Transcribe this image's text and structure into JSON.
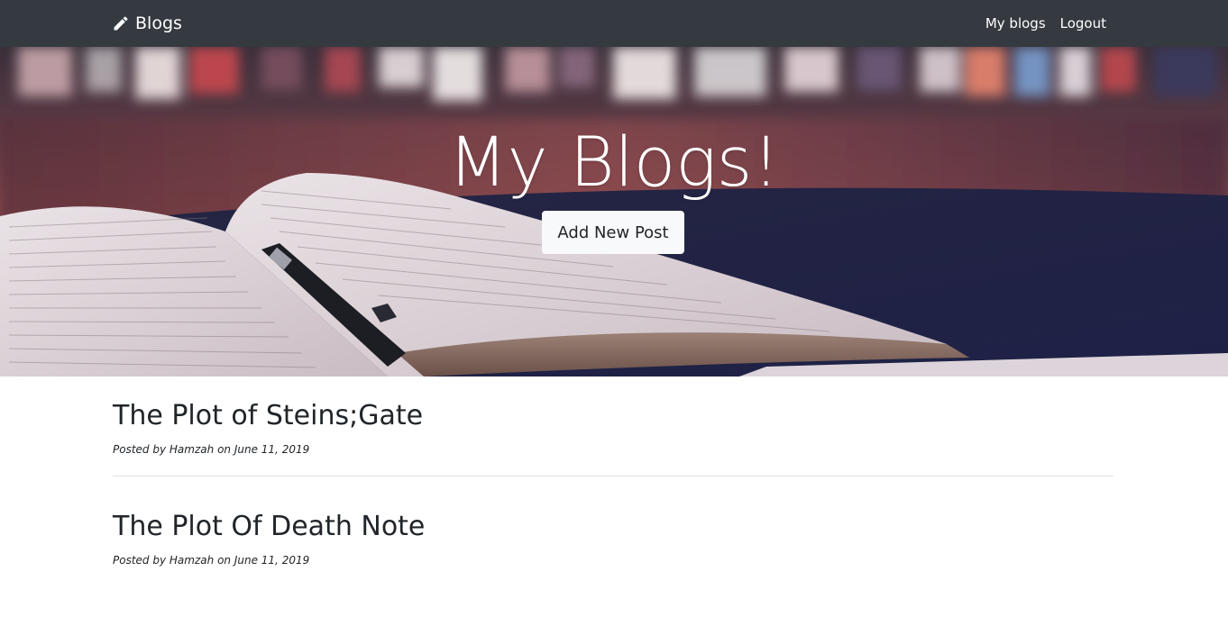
{
  "navbar": {
    "brand": "Blogs",
    "links": [
      "My blogs",
      "Logout"
    ]
  },
  "hero": {
    "title": "My Blogs!",
    "button_label": "Add New Post"
  },
  "posts": [
    {
      "title": "The Plot of Steins;Gate",
      "meta_prefix": "Posted by",
      "author": "Hamzah",
      "meta_mid": "on",
      "date": "June 11, 2019"
    },
    {
      "title": "The Plot Of Death Note",
      "meta_prefix": "Posted by",
      "author": "Hamzah",
      "meta_mid": "on",
      "date": "June 11, 2019"
    }
  ],
  "colors": {
    "navbar_bg": "#343a40",
    "button_bg": "#f8f9fa",
    "divider": "#e1e1e1"
  },
  "icons": {
    "brand_icon": "pencil-icon"
  }
}
